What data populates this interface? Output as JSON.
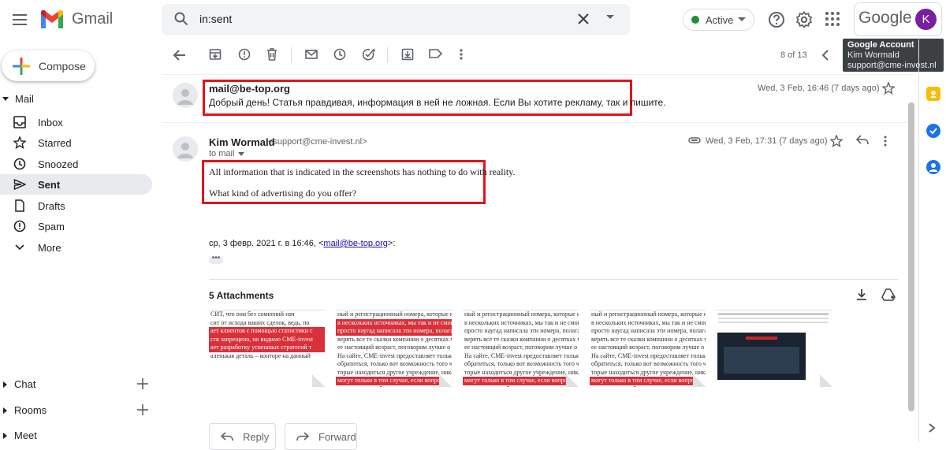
{
  "header": {
    "app_name": "Gmail",
    "search_query": "in:sent",
    "status_label": "Active",
    "google_label": "Google",
    "avatar_letter": "K",
    "tooltip": {
      "title": "Google Account",
      "name": "Kim Wormald",
      "email": "support@cme-invest.nl"
    }
  },
  "sidebar": {
    "compose_label": "Compose",
    "section_label": "Mail",
    "items": [
      {
        "label": "Inbox",
        "icon": "inbox-icon"
      },
      {
        "label": "Starred",
        "icon": "star-icon"
      },
      {
        "label": "Snoozed",
        "icon": "clock-icon"
      },
      {
        "label": "Sent",
        "icon": "send-icon",
        "selected": true
      },
      {
        "label": "Drafts",
        "icon": "draft-icon"
      },
      {
        "label": "Spam",
        "icon": "spam-icon"
      },
      {
        "label": "More",
        "icon": "chevron-down-icon"
      }
    ],
    "bottom": [
      {
        "label": "Chat"
      },
      {
        "label": "Rooms"
      },
      {
        "label": "Meet"
      }
    ]
  },
  "toolbar": {
    "page_count": "8 of 13"
  },
  "thread": {
    "message1": {
      "from": "mail@be-top.org",
      "snippet": "Добрый день! Статья правдивая, информация в ней не ложная. Если Вы хотите рекламу, так и пишите.",
      "date": "Wed, 3 Feb, 16:46 (7 days ago)"
    },
    "message2": {
      "sender_name": "Kim Wormald",
      "sender_email": "<support@cme-invest.nl>",
      "to_label": "to mail",
      "date": "Wed, 3 Feb, 17:31 (7 days ago)",
      "body_line1": "All information that is indicated in the screenshots has nothing to do with reality.",
      "body_line2": "What kind of advertising do you offer?",
      "quote_prefix": "ср, 3 февр. 2021 г. в 16:46, <",
      "quote_link": "mail@be-top.org",
      "quote_suffix": ">:",
      "ellipsis": "•••"
    },
    "attachments": {
      "title": "5 Attachments",
      "count": 5
    },
    "actions": {
      "reply_label": "Reply",
      "forward_label": "Forward"
    }
  },
  "colors": {
    "accent_red": "#e3141b",
    "selected_bg": "#e8eaed",
    "active_green": "#1e8e3e",
    "avatar_purple": "#7b1fa2"
  }
}
